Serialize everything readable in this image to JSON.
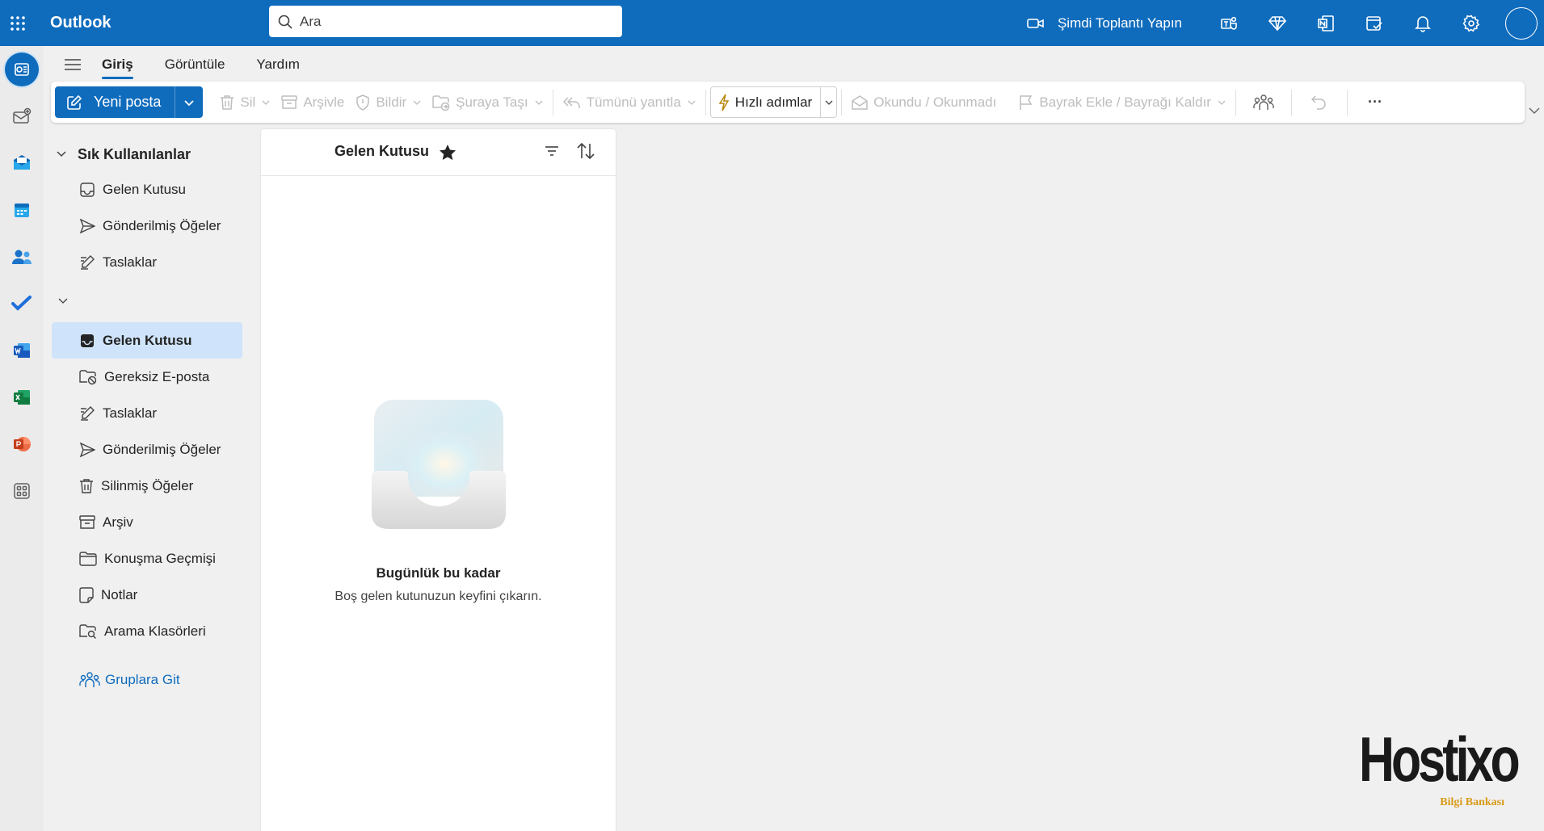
{
  "app": {
    "title": "Outlook"
  },
  "search": {
    "placeholder": "Ara"
  },
  "topbar": {
    "meet_label": "Şimdi Toplantı Yapın"
  },
  "tabs": [
    {
      "label": "Giriş",
      "active": true
    },
    {
      "label": "Görüntüle",
      "active": false
    },
    {
      "label": "Yardım",
      "active": false
    }
  ],
  "toolbar": {
    "new_mail": "Yeni posta",
    "delete": "Sil",
    "archive": "Arşivle",
    "report": "Bildir",
    "move_to": "Şuraya Taşı",
    "reply_all": "Tümünü yanıtla",
    "quick_steps": "Hızlı adımlar",
    "read_unread": "Okundu / Okunmadı",
    "flag": "Bayrak Ekle / Bayrağı Kaldır",
    "more": "···"
  },
  "favorites": {
    "header": "Sık Kullanılanlar",
    "items": [
      {
        "label": "Gelen Kutusu",
        "icon": "inbox-icon"
      },
      {
        "label": "Gönderilmiş Öğeler",
        "icon": "send-icon"
      },
      {
        "label": "Taslaklar",
        "icon": "draft-icon"
      }
    ]
  },
  "account": {
    "items": [
      {
        "label": "Gelen Kutusu",
        "icon": "inbox-icon",
        "selected": true
      },
      {
        "label": "Gereksiz E-posta",
        "icon": "junk-icon"
      },
      {
        "label": "Taslaklar",
        "icon": "draft-icon"
      },
      {
        "label": "Gönderilmiş Öğeler",
        "icon": "send-icon"
      },
      {
        "label": "Silinmiş Öğeler",
        "icon": "trash-icon"
      },
      {
        "label": "Arşiv",
        "icon": "archive-icon"
      },
      {
        "label": "Konuşma Geçmişi",
        "icon": "folder-icon"
      },
      {
        "label": "Notlar",
        "icon": "note-icon"
      },
      {
        "label": "Arama Klasörleri",
        "icon": "search-folder-icon"
      }
    ],
    "groups_link": "Gruplara Git"
  },
  "message_list": {
    "title": "Gelen Kutusu",
    "empty_title": "Bugünlük bu kadar",
    "empty_subtitle": "Boş gelen kutunuzun keyfini çıkarın."
  },
  "watermark": {
    "brand": "Hostixo",
    "tagline": "Bilgi Bankası"
  },
  "colors": {
    "brand": "#0f6cbd",
    "selected": "#cfe4fa",
    "disabled": "#bdbdbd",
    "watermark_accent": "#d89a18"
  }
}
